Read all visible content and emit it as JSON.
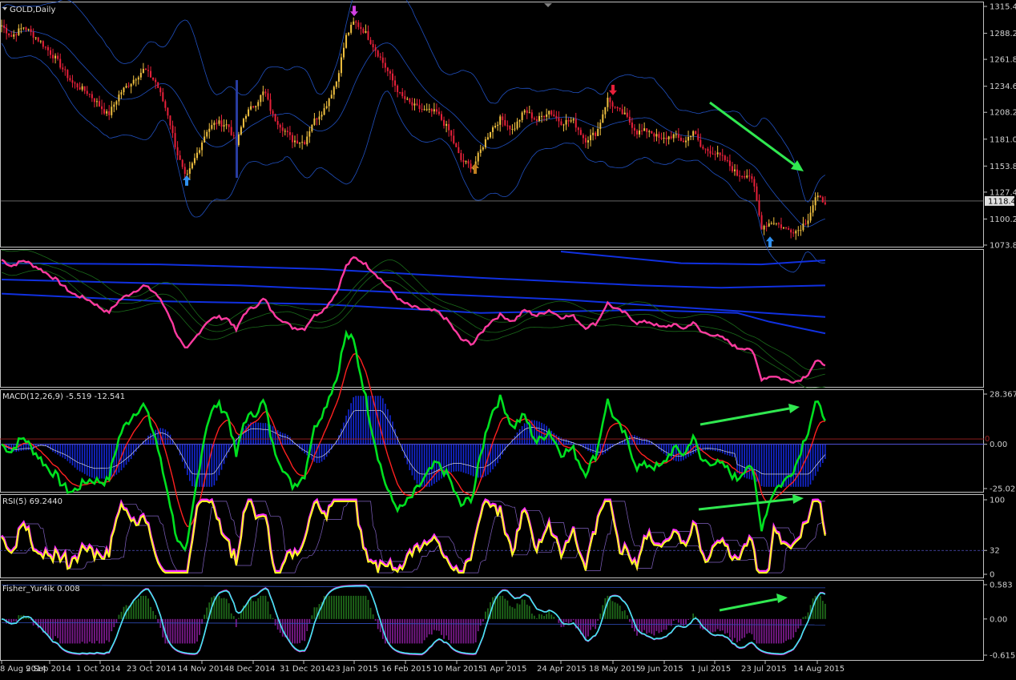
{
  "colors": {
    "background": "#000000",
    "frame": "#c0c0c0",
    "candle_up": "#f0c040",
    "candle_down": "#e8203a",
    "band": "#2050c0",
    "ma_slow": "#1030e0",
    "pink": "#ff3aa0",
    "green_env": "#1a6a1a",
    "macd_line": "#00e020",
    "macd_signal": "#ff2020",
    "macd_hist": "#1428d8",
    "rsi_main": "#ffff20",
    "rsi_fast": "#ff30ff",
    "fisher_pos": "#1f6a1a",
    "fisher_neg": "#7a1a8a",
    "fisher_line": "#40e8f0",
    "arrow_green": "#30e850",
    "arrow_blue": "#3090f0",
    "arrow_orange": "#c08020",
    "arrow_magenta": "#d040e0"
  },
  "chart_data": [
    {
      "type": "candlestick",
      "title": "GOLD,Daily",
      "ylim": [
        1073.8,
        1315.4
      ],
      "y_ticks": [
        "1315.40",
        "1288.20",
        "1261.80",
        "1234.60",
        "1208.20",
        "1181.00",
        "1153.80",
        "1127.40",
        "1100.20",
        "1073.80"
      ],
      "current_price": "1118.46",
      "x_ticks": [
        "8 Aug 2014",
        "9 Sep 2014",
        "1 Oct 2014",
        "23 Oct 2014",
        "14 Nov 2014",
        "8 Dec 2014",
        "31 Dec 2014",
        "23 Jan 2015",
        "16 Feb 2015",
        "10 Mar 2015",
        "1 Apr 2015",
        "24 Apr 2015",
        "18 May 2015",
        "9 Jun 2015",
        "1 Jul 2015",
        "23 Jul 2015",
        "14 Aug 2015"
      ],
      "close_path": [
        [
          0,
          1298
        ],
        [
          14,
          1285
        ],
        [
          30,
          1295
        ],
        [
          50,
          1280
        ],
        [
          70,
          1262
        ],
        [
          90,
          1238
        ],
        [
          110,
          1228
        ],
        [
          135,
          1205
        ],
        [
          150,
          1228
        ],
        [
          165,
          1240
        ],
        [
          180,
          1252
        ],
        [
          195,
          1238
        ],
        [
          210,
          1205
        ],
        [
          220,
          1170
        ],
        [
          232,
          1140
        ],
        [
          245,
          1165
        ],
        [
          258,
          1190
        ],
        [
          270,
          1198
        ],
        [
          285,
          1195
        ],
        [
          295,
          1175
        ],
        [
          305,
          1205
        ],
        [
          320,
          1218
        ],
        [
          330,
          1230
        ],
        [
          340,
          1205
        ],
        [
          350,
          1195
        ],
        [
          365,
          1180
        ],
        [
          380,
          1178
        ],
        [
          390,
          1198
        ],
        [
          405,
          1212
        ],
        [
          420,
          1240
        ],
        [
          432,
          1285
        ],
        [
          442,
          1300
        ],
        [
          455,
          1290
        ],
        [
          470,
          1270
        ],
        [
          485,
          1248
        ],
        [
          500,
          1225
        ],
        [
          515,
          1215
        ],
        [
          530,
          1210
        ],
        [
          545,
          1208
        ],
        [
          560,
          1190
        ],
        [
          575,
          1160
        ],
        [
          590,
          1152
        ],
        [
          600,
          1170
        ],
        [
          612,
          1190
        ],
        [
          625,
          1202
        ],
        [
          640,
          1190
        ],
        [
          655,
          1210
        ],
        [
          670,
          1200
        ],
        [
          685,
          1210
        ],
        [
          700,
          1198
        ],
        [
          715,
          1200
        ],
        [
          730,
          1180
        ],
        [
          745,
          1188
        ],
        [
          758,
          1222
        ],
        [
          768,
          1212
        ],
        [
          780,
          1205
        ],
        [
          795,
          1188
        ],
        [
          810,
          1190
        ],
        [
          825,
          1180
        ],
        [
          840,
          1185
        ],
        [
          855,
          1178
        ],
        [
          865,
          1190
        ],
        [
          875,
          1172
        ],
        [
          890,
          1168
        ],
        [
          905,
          1160
        ],
        [
          920,
          1145
        ],
        [
          935,
          1145
        ],
        [
          942,
          1130
        ],
        [
          950,
          1092
        ],
        [
          965,
          1098
        ],
        [
          980,
          1090
        ],
        [
          995,
          1088
        ],
        [
          1008,
          1100
        ],
        [
          1018,
          1122
        ],
        [
          1030,
          1118
        ]
      ],
      "markers": [
        {
          "label": "up",
          "x": 233,
          "price": 1138,
          "color": "#3090f0"
        },
        {
          "label": "up",
          "x": 593,
          "price": 1150,
          "color": "#c08020"
        },
        {
          "label": "up",
          "x": 961,
          "price": 1076,
          "color": "#3090f0"
        },
        {
          "label": "down",
          "x": 442,
          "price": 1312,
          "color": "#d040e0"
        },
        {
          "label": "down",
          "x": 765,
          "price": 1232,
          "color": "#e8203a"
        }
      ]
    },
    {
      "type": "line",
      "title": ""
    },
    {
      "type": "bar+line",
      "title": "MACD(12,26,9) -5.519 -12.541",
      "ylim": [
        -25.025,
        28.367
      ],
      "y_ticks": [
        "28.367",
        "0.00",
        "-25.025"
      ],
      "baseline_label": "0"
    },
    {
      "type": "line",
      "title": "RSI(5) 69.2440",
      "ylim": [
        0,
        100
      ],
      "y_ticks": [
        "100",
        "32",
        "0"
      ],
      "level": 32,
      "last_value": 69.244
    },
    {
      "type": "bar+line",
      "title": "Fisher_Yur4ik 0.008",
      "ylim": [
        -0.615,
        0.583
      ],
      "y_ticks": [
        "0.583",
        "0.00",
        "-0.615"
      ],
      "last_value": 0.008
    }
  ]
}
